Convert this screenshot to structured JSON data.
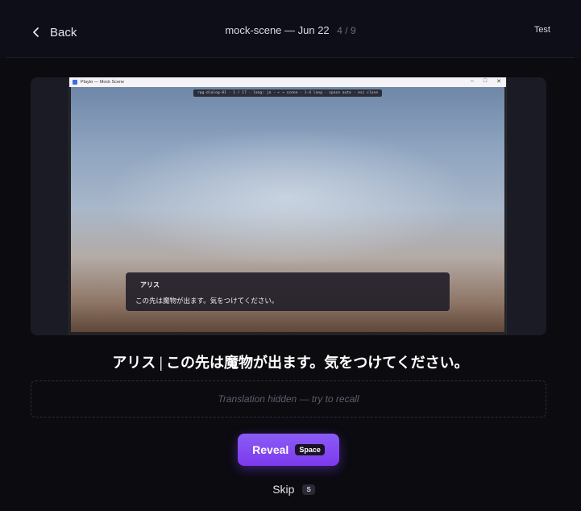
{
  "header": {
    "back_label": "Back",
    "title": "mock-scene — Jun 22",
    "progress": "4 / 9",
    "test_label": "Test"
  },
  "screenshot": {
    "window_title": "Playto — Mock Scene",
    "window_controls": [
      "–",
      "□",
      "✕"
    ],
    "hud": "rpg-dialog-01 · 1 / 17 · lang: ja · ← → scene · 1-4 lang · space auto · esc close",
    "dialog": {
      "speaker": "アリス",
      "line": "この先は魔物が出ます。気をつけてください。"
    }
  },
  "subtitle": {
    "speaker": "アリス",
    "separator": "|",
    "line": "この先は魔物が出ます。気をつけてください。"
  },
  "translation": {
    "placeholder": "Translation hidden — try to recall"
  },
  "actions": {
    "reveal_label": "Reveal",
    "reveal_key": "Space",
    "skip_label": "Skip",
    "skip_key": "S"
  },
  "colors": {
    "accent": "#7c3aed",
    "background": "#0b0b10"
  }
}
